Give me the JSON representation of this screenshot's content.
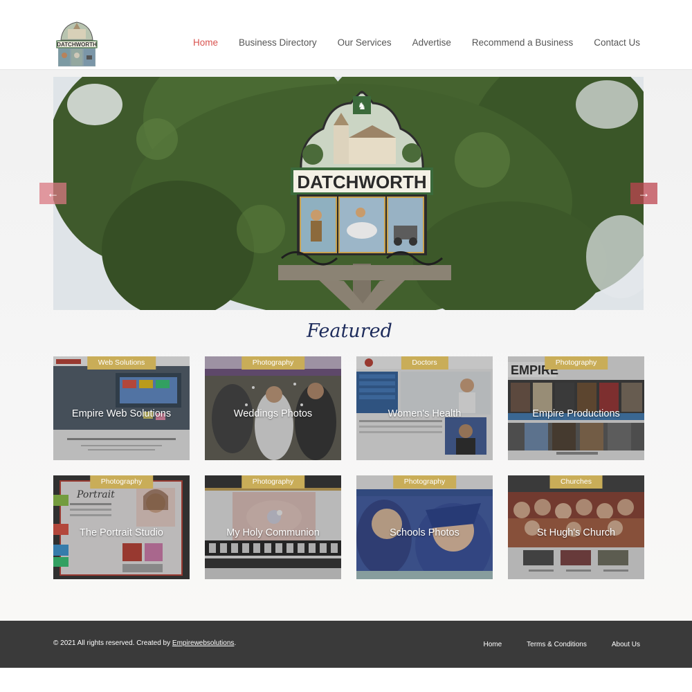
{
  "brand": {
    "logo_text": "DATCHWORTH"
  },
  "nav": {
    "items": [
      {
        "label": "Home",
        "active": true
      },
      {
        "label": "Business Directory",
        "active": false
      },
      {
        "label": "Our Services",
        "active": false
      },
      {
        "label": "Advertise",
        "active": false
      },
      {
        "label": "Recommend a Business",
        "active": false
      },
      {
        "label": "Contact Us",
        "active": false
      }
    ]
  },
  "slider": {
    "sign_text": "DATCHWORTH",
    "prev_icon": "←",
    "next_icon": "→"
  },
  "featured": {
    "heading": "Featured",
    "cards": [
      {
        "category": "Web Solutions",
        "title": "Empire Web Solutions"
      },
      {
        "category": "Photography",
        "title": "Weddings Photos"
      },
      {
        "category": "Doctors",
        "title": "Women's Health"
      },
      {
        "category": "Photography",
        "title": "Empire Productions"
      },
      {
        "category": "Photography",
        "title": "The Portrait Studio"
      },
      {
        "category": "Photography",
        "title": "My Holy Communion"
      },
      {
        "category": "Photography",
        "title": "Schools Photos"
      },
      {
        "category": "Churches",
        "title": "St Hugh's Church"
      }
    ]
  },
  "footer": {
    "copyright_prefix": "© 2021 All rights reserved. Created by ",
    "copyright_link": "Empirewebsolutions",
    "copyright_suffix": ".",
    "links": [
      "Home",
      "Terms & Conditions",
      "About Us"
    ]
  },
  "colors": {
    "accent": "#d9534f",
    "badge": "#c9ad58",
    "heading": "#1d2b5b",
    "footer_bg": "#3a3a3a"
  }
}
